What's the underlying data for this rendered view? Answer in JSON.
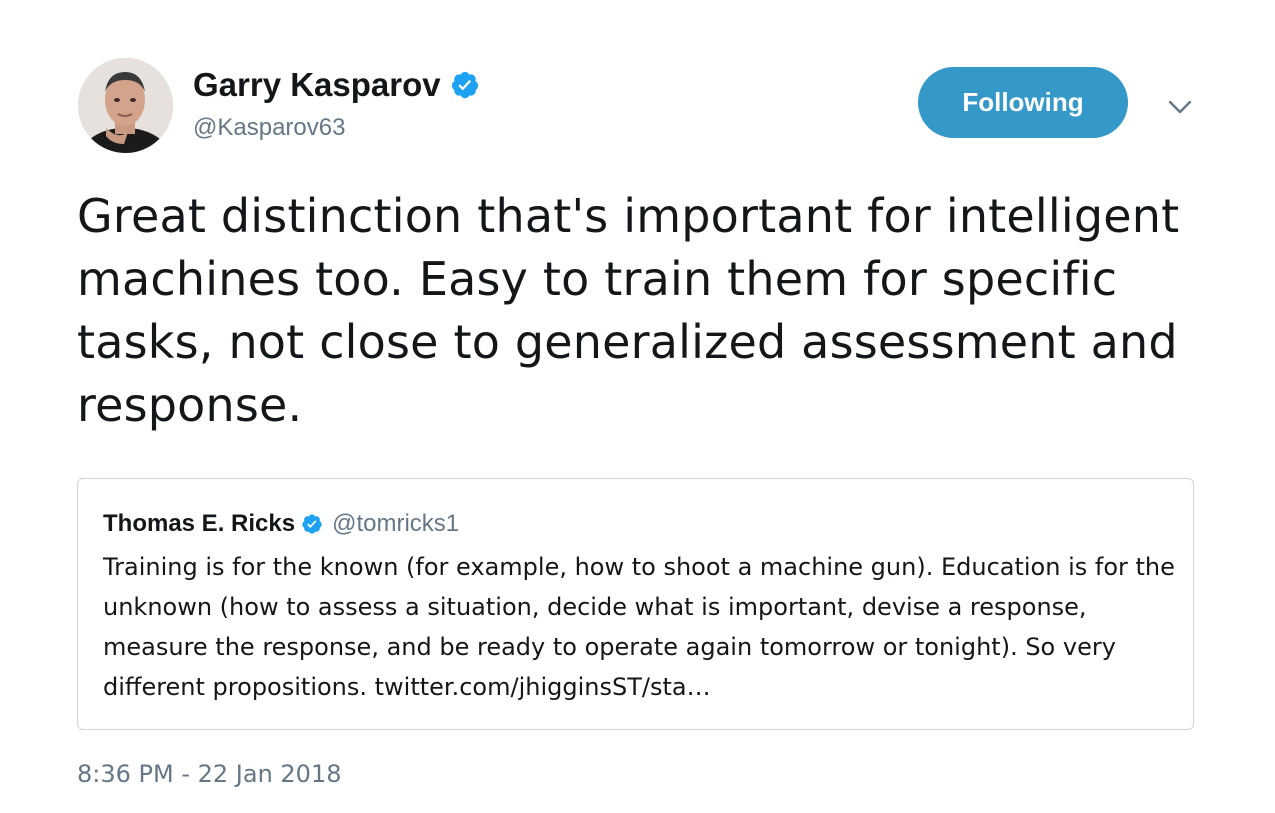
{
  "author": {
    "display_name": "Garry Kasparov",
    "handle": "@Kasparov63",
    "verified": true,
    "avatar_icon": "profile-photo"
  },
  "follow_button": {
    "label": "Following"
  },
  "menu": {
    "icon": "chevron-down-icon"
  },
  "tweet": {
    "text": "Great distinction that's important for intelligent machines too. Easy to train them for specific tasks, not close to generalized assessment and response."
  },
  "quoted_tweet": {
    "display_name": "Thomas E. Ricks",
    "handle": "@tomricks1",
    "verified": true,
    "text": "Training is for the known (for example, how to shoot a machine gun). Education is for the unknown (how to assess a situation, decide what is important, devise a response, measure the response, and be ready to operate again tomorrow or tonight). So very different propositions. ",
    "link_text": "twitter.com/jhigginsST/sta…"
  },
  "meta": {
    "timestamp": "8:36 PM - 22 Jan 2018"
  },
  "colors": {
    "accent": "#3498c9",
    "verified_badge": "#1da1f2",
    "secondary_text": "#657786",
    "border": "#ccd6dd"
  }
}
